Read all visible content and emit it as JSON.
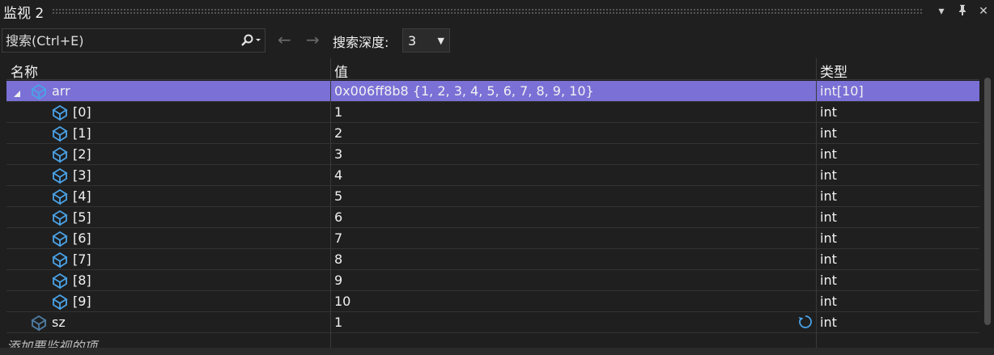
{
  "window": {
    "title": "监视 2"
  },
  "toolbar": {
    "search_placeholder": "搜索(Ctrl+E)",
    "depth_label": "搜索深度:",
    "depth_value": "3"
  },
  "columns": {
    "name": "名称",
    "value": "值",
    "type": "类型"
  },
  "rows": [
    {
      "name": "arr",
      "value": "0x006ff8b8 {1, 2, 3, 4, 5, 6, 7, 8, 9, 10}",
      "type": "int[10]",
      "level": 0,
      "expanded": true,
      "selected": true
    },
    {
      "name": "[0]",
      "value": "1",
      "type": "int",
      "level": 1
    },
    {
      "name": "[1]",
      "value": "2",
      "type": "int",
      "level": 1
    },
    {
      "name": "[2]",
      "value": "3",
      "type": "int",
      "level": 1
    },
    {
      "name": "[3]",
      "value": "4",
      "type": "int",
      "level": 1
    },
    {
      "name": "[4]",
      "value": "5",
      "type": "int",
      "level": 1
    },
    {
      "name": "[5]",
      "value": "6",
      "type": "int",
      "level": 1
    },
    {
      "name": "[6]",
      "value": "7",
      "type": "int",
      "level": 1
    },
    {
      "name": "[7]",
      "value": "8",
      "type": "int",
      "level": 1
    },
    {
      "name": "[8]",
      "value": "9",
      "type": "int",
      "level": 1
    },
    {
      "name": "[9]",
      "value": "10",
      "type": "int",
      "level": 1
    },
    {
      "name": "sz",
      "value": "1",
      "type": "int",
      "level": 0,
      "refresh": true,
      "dim": true
    }
  ],
  "add_item_label": "添加要监视的项",
  "colors": {
    "selection": "#7a70d6",
    "icon": "#4aa3e8",
    "background": "#1f1f1f"
  }
}
